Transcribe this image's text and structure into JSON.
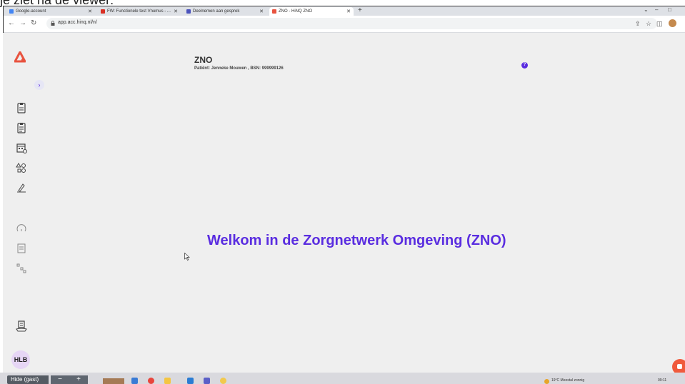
{
  "caption": "je ziet na de viewer:",
  "browser": {
    "tabs": [
      {
        "label": "Google-account",
        "color": "#4285f4"
      },
      {
        "label": "FW: Functionele test Vnumus - ...",
        "color": "#d93025"
      },
      {
        "label": "Deelnemen aan gesprek",
        "color": "#4b53bc"
      },
      {
        "label": "ZNO - HiNQ ZNO",
        "color": "#e8533f"
      }
    ],
    "new_tab": "+",
    "url": "app.acc.hinq.nl/n/",
    "window_controls": [
      "⌄",
      "–",
      "□"
    ]
  },
  "app": {
    "title": "ZNO",
    "patient_info": "Patiënt: Jenneke Mouwen , BSN: 999999126",
    "help_label": "?",
    "welcome": "Welkom in de Zorgnetwerk Omgeving (ZNO)",
    "expand_label": "›",
    "avatar_initials": "HLB",
    "accent_color": "#5a2de0",
    "brand_color": "#e8533f"
  },
  "taskbar": {
    "guest_label": "Hide (gast)",
    "zoom_out": "−",
    "zoom_in": "+",
    "weather": "19°C Meestal zonnig",
    "time": "09:11"
  }
}
